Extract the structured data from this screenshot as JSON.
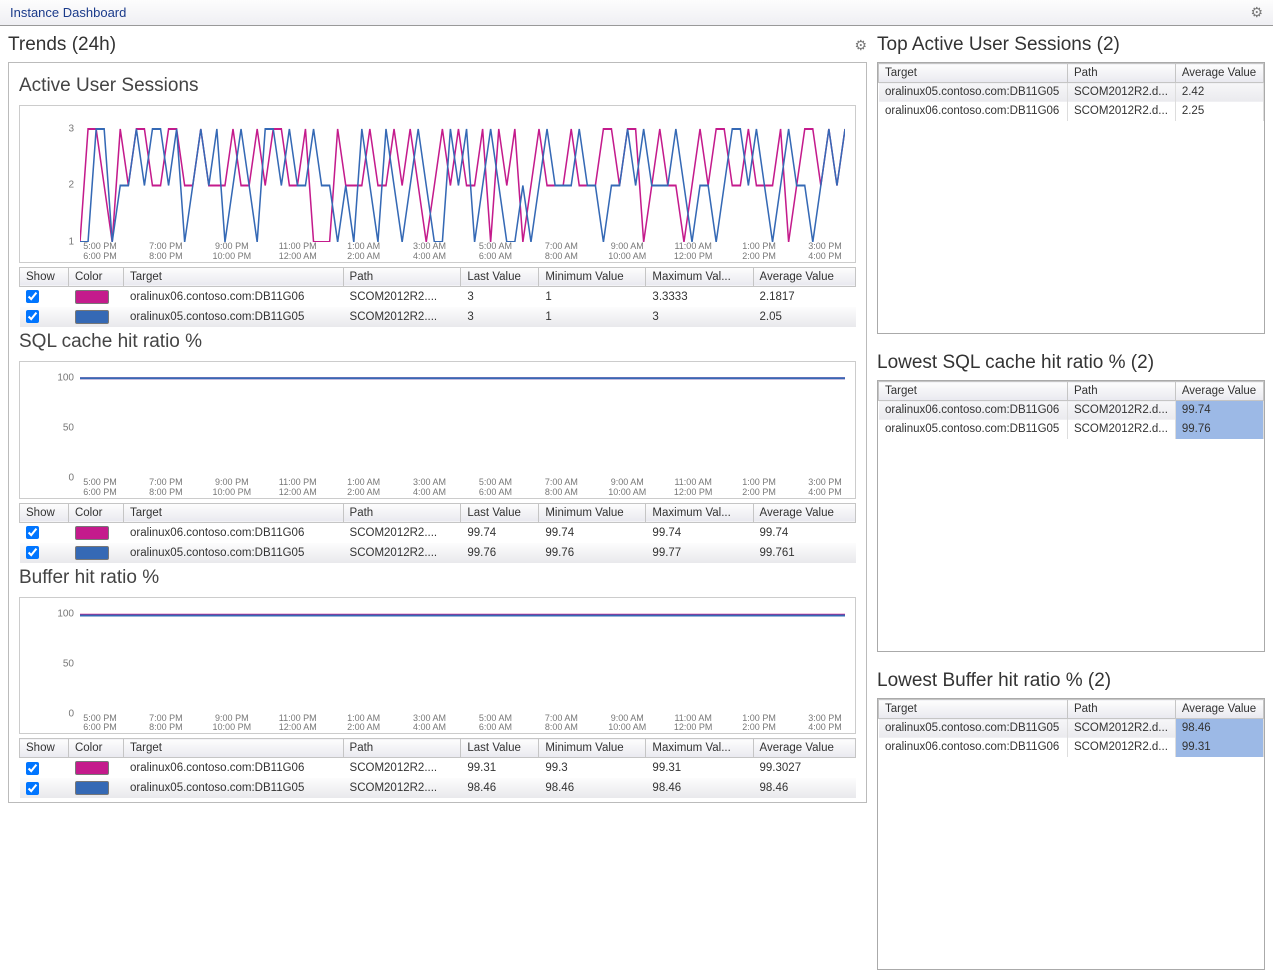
{
  "header": {
    "title": "Instance Dashboard"
  },
  "colors": {
    "seriesA": "#c41b8c",
    "seriesB": "#3569b5"
  },
  "trends": {
    "title": "Trends (24h)",
    "x_ticks_top": [
      "5:00 PM",
      "7:00 PM",
      "9:00 PM",
      "11:00 PM",
      "1:00 AM",
      "3:00 AM",
      "5:00 AM",
      "7:00 AM",
      "9:00 AM",
      "11:00 AM",
      "1:00 PM",
      "3:00 PM"
    ],
    "x_ticks_bot": [
      "6:00 PM",
      "8:00 PM",
      "10:00 PM",
      "12:00 AM",
      "2:00 AM",
      "4:00 AM",
      "6:00 AM",
      "8:00 AM",
      "10:00 AM",
      "12:00 PM",
      "2:00 PM",
      "4:00 PM"
    ],
    "legend_cols": [
      "Show",
      "Color",
      "Target",
      "Path",
      "Last Value",
      "Minimum Value",
      "Maximum Val...",
      "Average Value"
    ]
  },
  "chart_data": [
    {
      "id": "active",
      "type": "line",
      "title": "Active User Sessions",
      "ylim": [
        1,
        3.3
      ],
      "y_ticks": [
        1,
        2,
        3
      ],
      "series": [
        {
          "name": "oralinux06.contoso.com:DB11G06",
          "color_key": "seriesA",
          "values": [
            1,
            3,
            3,
            2,
            1,
            3,
            2,
            3,
            3,
            2,
            2,
            3,
            3,
            2,
            2,
            3,
            2,
            2,
            2,
            3,
            2,
            2,
            3,
            2,
            3,
            3,
            2,
            2,
            3,
            1,
            1,
            1,
            3,
            2,
            2,
            2,
            3,
            2,
            2,
            3,
            2,
            3,
            2,
            1,
            2,
            3,
            2,
            3,
            2,
            2,
            3,
            1,
            3,
            2,
            3,
            1,
            2,
            3,
            2,
            2,
            2,
            3,
            2,
            2,
            2,
            3,
            3,
            2,
            3,
            3,
            1,
            2,
            3,
            2,
            2,
            1,
            2,
            3,
            2,
            3,
            3,
            2,
            2,
            3,
            2,
            2,
            2,
            3,
            1,
            2,
            3,
            3,
            2,
            3,
            2,
            3
          ]
        },
        {
          "name": "oralinux05.contoso.com:DB11G05",
          "color_key": "seriesB",
          "values": [
            1,
            1,
            3,
            3,
            1,
            2,
            2,
            3,
            2,
            3,
            3,
            2,
            3,
            1,
            2,
            3,
            2,
            3,
            1,
            2,
            3,
            2,
            1,
            3,
            3,
            2,
            3,
            2,
            2,
            3,
            2,
            2,
            1,
            2,
            1,
            3,
            2,
            1,
            3,
            2,
            1,
            2,
            3,
            2,
            1,
            1,
            3,
            2,
            3,
            1,
            2,
            3,
            2,
            1,
            1,
            2,
            1,
            2,
            3,
            2,
            2,
            2,
            3,
            2,
            2,
            1,
            2,
            2,
            3,
            2,
            3,
            2,
            2,
            2,
            3,
            2,
            1,
            2,
            2,
            1,
            2,
            3,
            3,
            2,
            3,
            2,
            1,
            2,
            3,
            2,
            2,
            1,
            2,
            3,
            2,
            3
          ]
        }
      ],
      "legend_rows": [
        {
          "target": "oralinux06.contoso.com:DB11G06",
          "path": "SCOM2012R2....",
          "last": "3",
          "min": "1",
          "max": "3.3333",
          "avg": "2.1817",
          "color_key": "seriesA"
        },
        {
          "target": "oralinux05.contoso.com:DB11G05",
          "path": "SCOM2012R2....",
          "last": "3",
          "min": "1",
          "max": "3",
          "avg": "2.05",
          "color_key": "seriesB"
        }
      ]
    },
    {
      "id": "sql",
      "type": "line",
      "title": "SQL cache hit ratio %",
      "ylim": [
        0,
        110
      ],
      "y_ticks": [
        0,
        50,
        100
      ],
      "flat_value": 100,
      "series": [
        {
          "name": "oralinux06.contoso.com:DB11G06",
          "color_key": "seriesA",
          "flat": 99.74
        },
        {
          "name": "oralinux05.contoso.com:DB11G05",
          "color_key": "seriesB",
          "flat": 99.76
        }
      ],
      "legend_rows": [
        {
          "target": "oralinux06.contoso.com:DB11G06",
          "path": "SCOM2012R2....",
          "last": "99.74",
          "min": "99.74",
          "max": "99.74",
          "avg": "99.74",
          "color_key": "seriesA"
        },
        {
          "target": "oralinux05.contoso.com:DB11G05",
          "path": "SCOM2012R2....",
          "last": "99.76",
          "min": "99.76",
          "max": "99.77",
          "avg": "99.761",
          "color_key": "seriesB"
        }
      ]
    },
    {
      "id": "buffer",
      "type": "line",
      "title": "Buffer hit ratio %",
      "ylim": [
        0,
        110
      ],
      "y_ticks": [
        0,
        50,
        100
      ],
      "flat_value": 100,
      "series": [
        {
          "name": "oralinux06.contoso.com:DB11G06",
          "color_key": "seriesA",
          "flat": 99.31
        },
        {
          "name": "oralinux05.contoso.com:DB11G05",
          "color_key": "seriesB",
          "flat": 98.46
        }
      ],
      "legend_rows": [
        {
          "target": "oralinux06.contoso.com:DB11G06",
          "path": "SCOM2012R2....",
          "last": "99.31",
          "min": "99.3",
          "max": "99.31",
          "avg": "99.3027",
          "color_key": "seriesA"
        },
        {
          "target": "oralinux05.contoso.com:DB11G05",
          "path": "SCOM2012R2....",
          "last": "98.46",
          "min": "98.46",
          "max": "98.46",
          "avg": "98.46",
          "color_key": "seriesB"
        }
      ]
    }
  ],
  "right_panels": [
    {
      "title": "Top Active User Sessions (2)",
      "cols": [
        "Target",
        "Path",
        "Average Value"
      ],
      "rows": [
        {
          "t": "oralinux05.contoso.com:DB11G05",
          "p": "SCOM2012R2.d...",
          "v": "2.42",
          "sel": true,
          "hl": false
        },
        {
          "t": "oralinux06.contoso.com:DB11G06",
          "p": "SCOM2012R2.d...",
          "v": "2.25",
          "sel": false,
          "hl": false
        }
      ]
    },
    {
      "title": "Lowest SQL cache hit ratio % (2)",
      "cols": [
        "Target",
        "Path",
        "Average Value"
      ],
      "rows": [
        {
          "t": "oralinux06.contoso.com:DB11G06",
          "p": "SCOM2012R2.d...",
          "v": "99.74",
          "sel": true,
          "hl": true
        },
        {
          "t": "oralinux05.contoso.com:DB11G05",
          "p": "SCOM2012R2.d...",
          "v": "99.76",
          "sel": false,
          "hl": true
        }
      ]
    },
    {
      "title": "Lowest Buffer hit ratio % (2)",
      "cols": [
        "Target",
        "Path",
        "Average Value"
      ],
      "rows": [
        {
          "t": "oralinux05.contoso.com:DB11G05",
          "p": "SCOM2012R2.d...",
          "v": "98.46",
          "sel": true,
          "hl": true
        },
        {
          "t": "oralinux06.contoso.com:DB11G06",
          "p": "SCOM2012R2.d...",
          "v": "99.31",
          "sel": false,
          "hl": true
        }
      ]
    }
  ]
}
